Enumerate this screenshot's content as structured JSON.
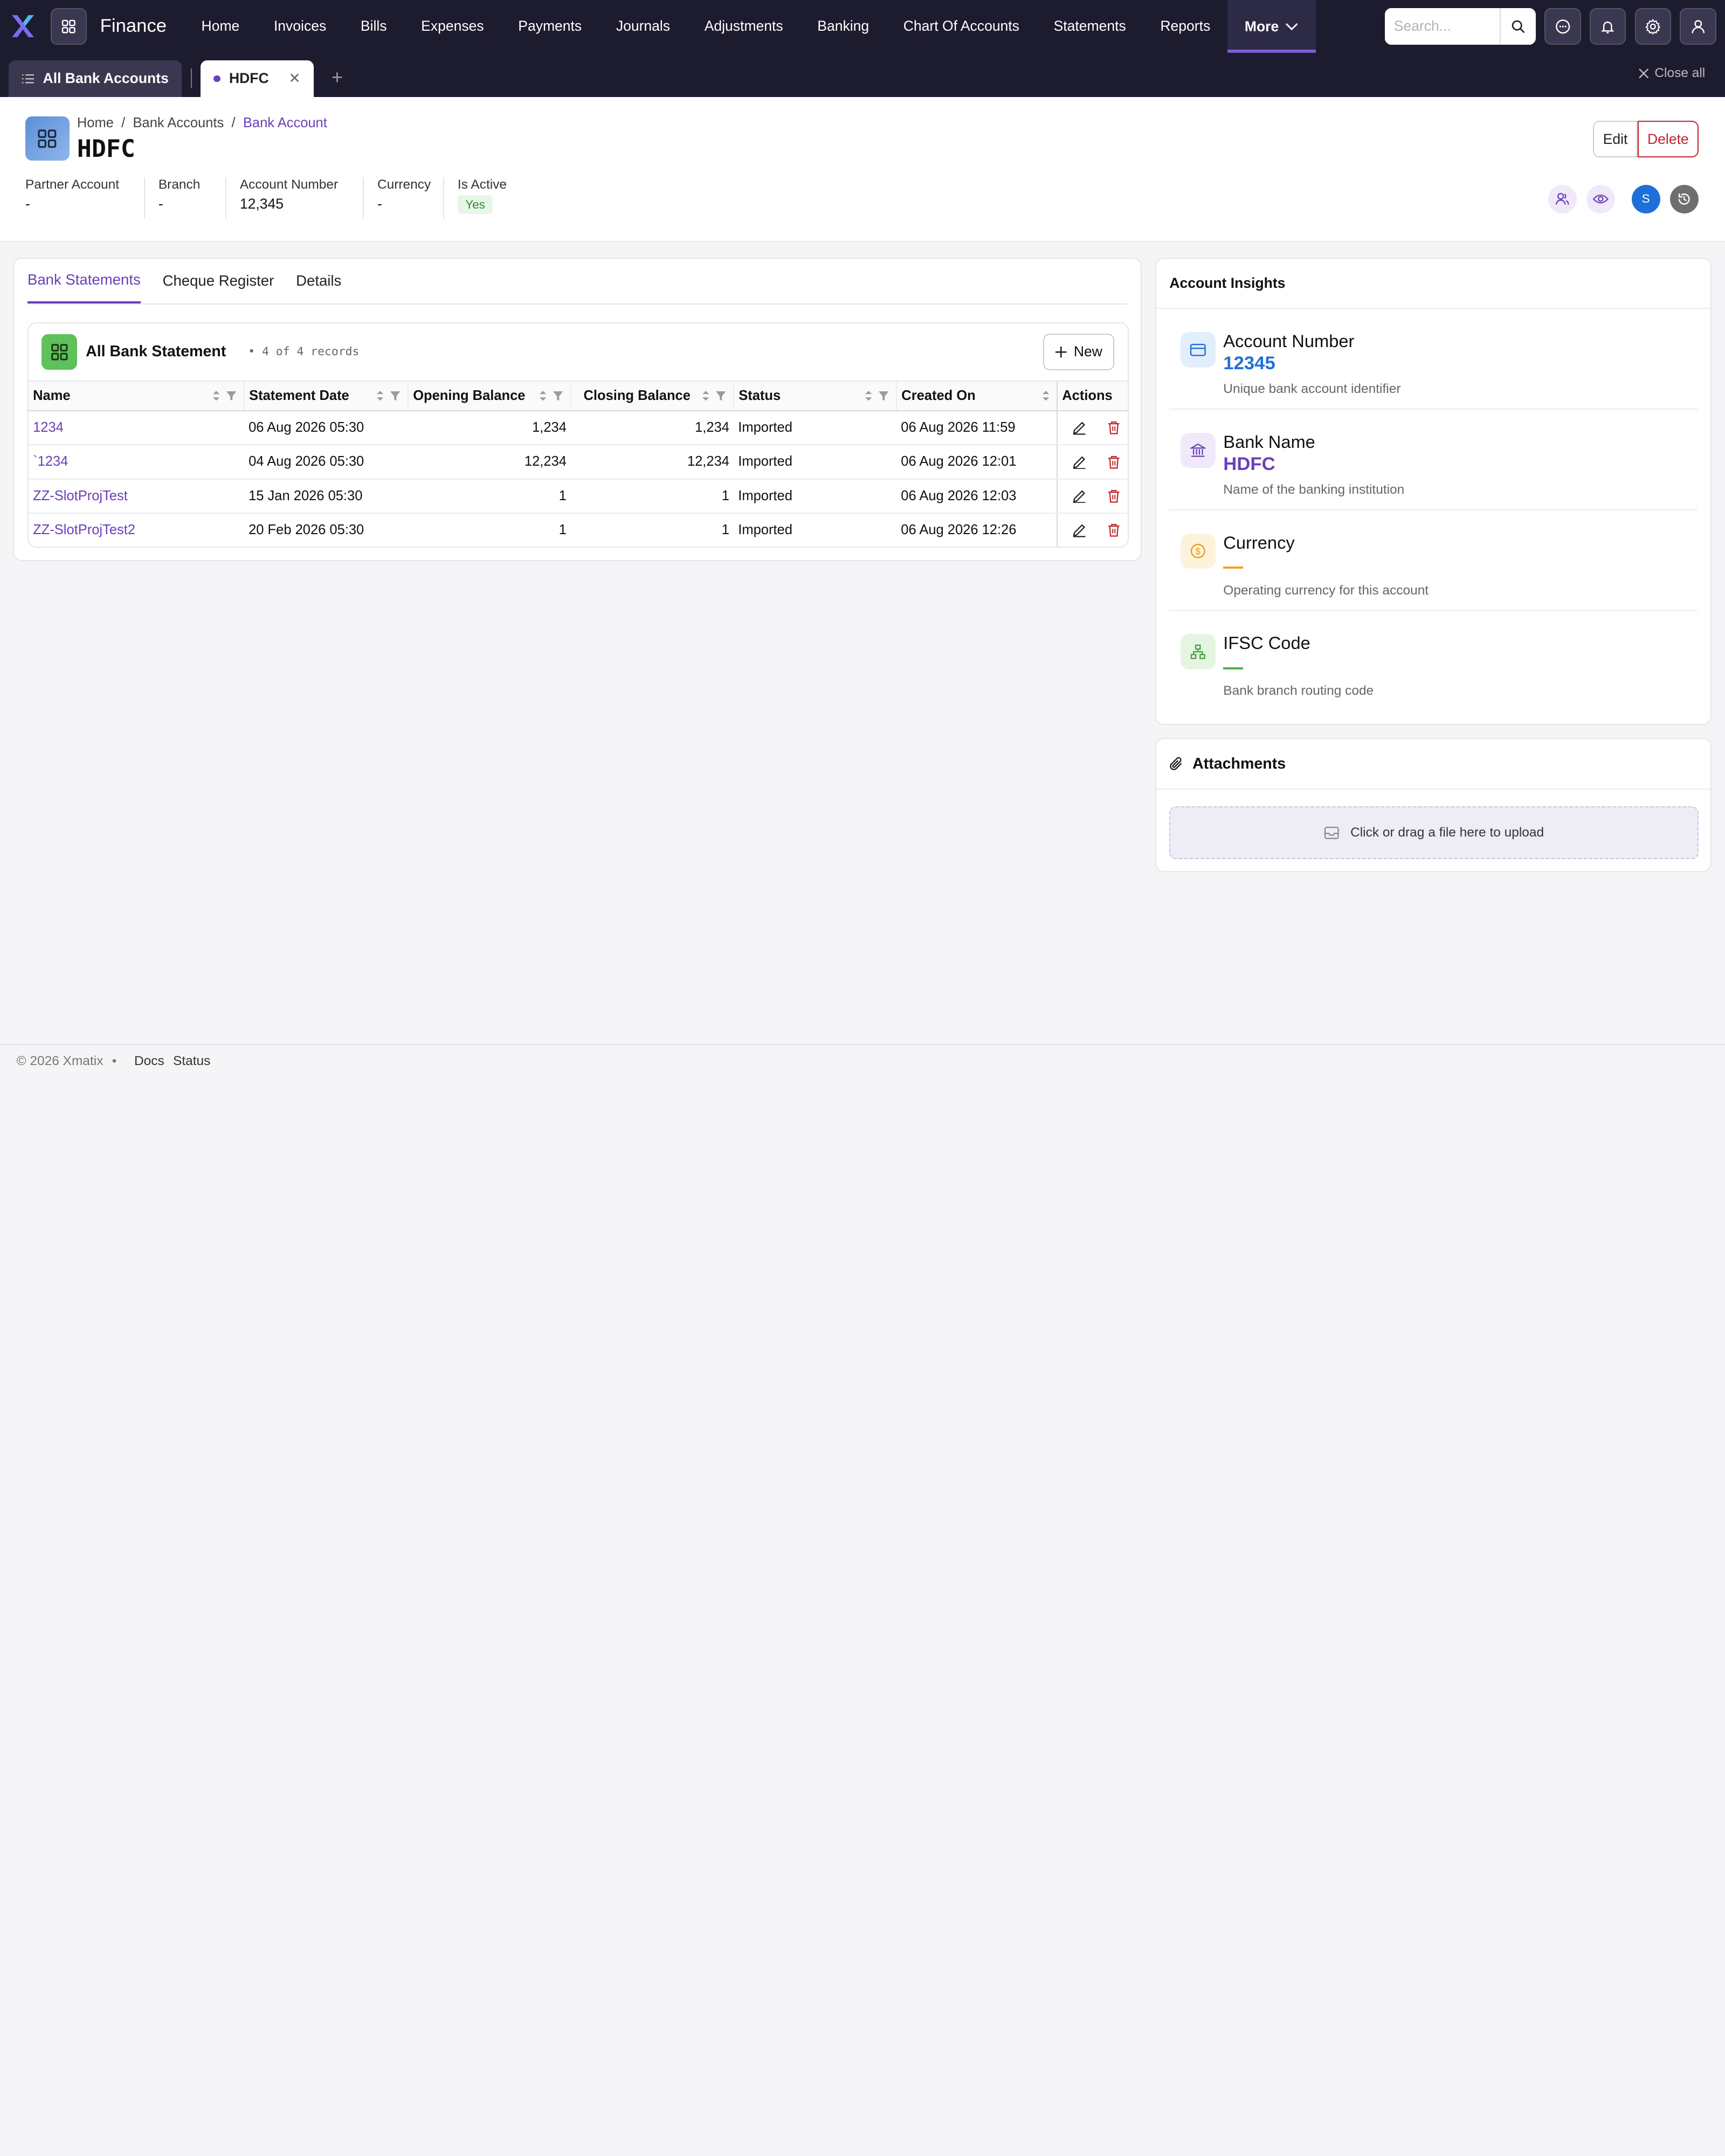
{
  "app": {
    "title": "Finance"
  },
  "nav": {
    "items": [
      "Home",
      "Invoices",
      "Bills",
      "Expenses",
      "Payments",
      "Journals",
      "Adjustments",
      "Banking",
      "Chart Of Accounts",
      "Statements",
      "Reports"
    ],
    "more_label": "More",
    "search_placeholder": "Search..."
  },
  "tabs": {
    "all_label": "All Bank Accounts",
    "active_label": "HDFC",
    "close_all": "Close all"
  },
  "breadcrumb": {
    "home": "Home",
    "parent": "Bank Accounts",
    "current": "Bank Account"
  },
  "record": {
    "title": "HDFC",
    "edit_label": "Edit",
    "delete_label": "Delete",
    "fields": [
      {
        "label": "Partner Account",
        "value": "-"
      },
      {
        "label": "Branch",
        "value": "-"
      },
      {
        "label": "Account Number",
        "value": "12,345"
      },
      {
        "label": "Currency",
        "value": "-"
      },
      {
        "label": "Is Active",
        "value": "Yes"
      }
    ],
    "avatar_letter": "S"
  },
  "panel": {
    "tabs": [
      "Bank Statements",
      "Cheque Register",
      "Details"
    ],
    "list_title": "All Bank Statement",
    "records": "4 of 4 records",
    "new_label": "New",
    "columns": [
      "Name",
      "Statement Date",
      "Opening Balance",
      "Closing Balance",
      "Status",
      "Created On",
      "Actions"
    ],
    "rows": [
      {
        "name": "1234",
        "date": "06 Aug 2026 05:30",
        "opening": "1,234",
        "closing": "1,234",
        "status": "Imported",
        "created": "06 Aug 2026 11:59"
      },
      {
        "name": "`1234",
        "date": "04 Aug 2026 05:30",
        "opening": "12,234",
        "closing": "12,234",
        "status": "Imported",
        "created": "06 Aug 2026 12:01"
      },
      {
        "name": "ZZ-SlotProjTest",
        "date": "15 Jan 2026 05:30",
        "opening": "1",
        "closing": "1",
        "status": "Imported",
        "created": "06 Aug 2026 12:03"
      },
      {
        "name": "ZZ-SlotProjTest2",
        "date": "20 Feb 2026 05:30",
        "opening": "1",
        "closing": "1",
        "status": "Imported",
        "created": "06 Aug 2026 12:26"
      }
    ]
  },
  "insights": {
    "title": "Account Insights",
    "items": [
      {
        "label": "Account Number",
        "value": "12345",
        "desc": "Unique bank account identifier"
      },
      {
        "label": "Bank Name",
        "value": "HDFC",
        "desc": "Name of the banking institution"
      },
      {
        "label": "Currency",
        "value": "",
        "desc": "Operating currency for this account"
      },
      {
        "label": "IFSC Code",
        "value": "",
        "desc": "Bank branch routing code"
      }
    ]
  },
  "attachments": {
    "title": "Attachments",
    "dropzone": "Click or drag a file here to upload"
  },
  "footer": {
    "copyright": "© 2026 Xmatix",
    "docs": "Docs",
    "status": "Status"
  },
  "colors": {
    "accent": "#6b3fb8",
    "nav_bg": "#1d1b2e",
    "danger": "#c0262d",
    "link_blue": "#1e6fd9",
    "currency_dash": "#f0a020",
    "ifsc_dash": "#4caf50"
  }
}
